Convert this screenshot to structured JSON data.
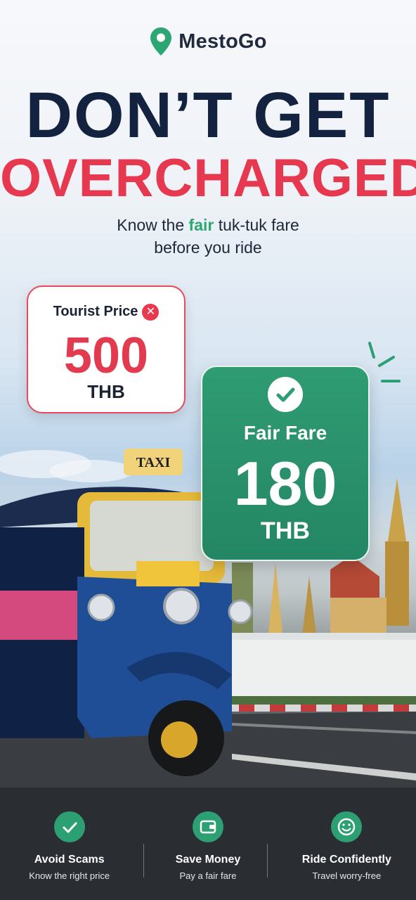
{
  "brand": {
    "name": "MestoGo",
    "accent": "#2ca773"
  },
  "headline": {
    "line1": "DON’T GET",
    "line2": "OVERCHARGED"
  },
  "tagline": {
    "before": "Know the ",
    "highlight": "fair",
    "after": " tuk-tuk fare",
    "line2": "before you ride"
  },
  "tourist": {
    "label": "Tourist Price",
    "icon": "x-circle-icon",
    "amount": "500",
    "currency": "THB",
    "color": "#e63950"
  },
  "fair": {
    "label": "Fair Fare",
    "icon": "check-circle-icon",
    "amount": "180",
    "currency": "THB",
    "color": "#2f9c73"
  },
  "scene": {
    "taxi_sign": "TAXI"
  },
  "features": [
    {
      "icon": "check-icon",
      "title": "Avoid Scams",
      "subtitle": "Know the right price"
    },
    {
      "icon": "wallet-icon",
      "title": "Save Money",
      "subtitle": "Pay a fair fare"
    },
    {
      "icon": "smile-icon",
      "title": "Ride Confidently",
      "subtitle": "Travel worry-free"
    }
  ]
}
